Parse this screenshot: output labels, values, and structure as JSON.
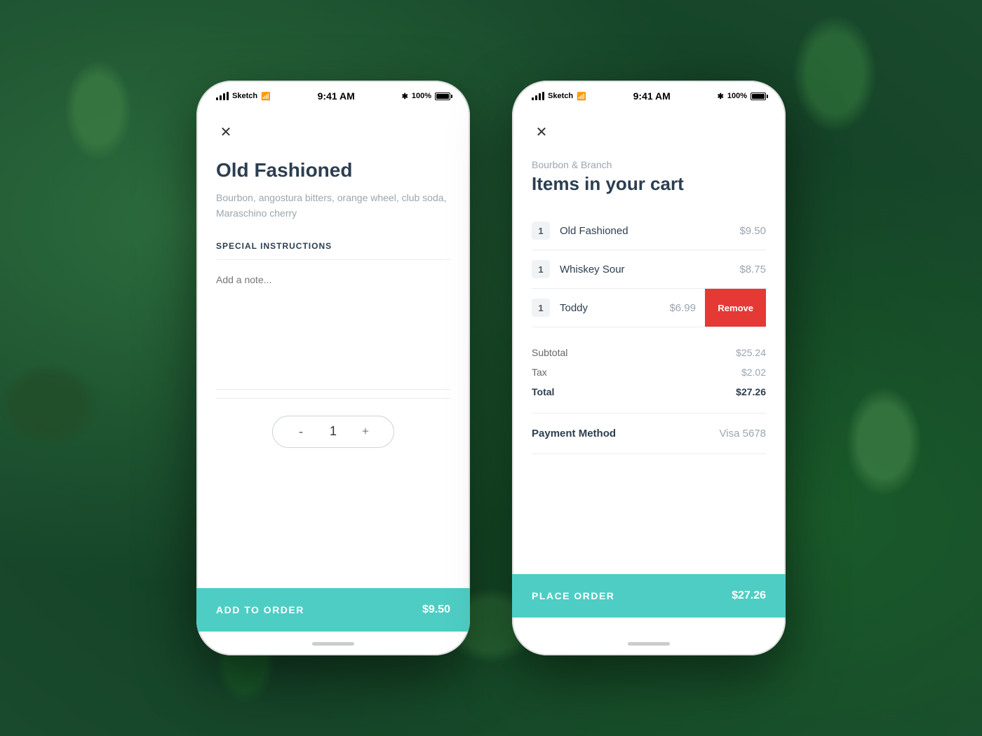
{
  "background": {
    "color": "#1a4a2e"
  },
  "phone_left": {
    "status_bar": {
      "carrier": "Sketch",
      "time": "9:41 AM",
      "battery_pct": "100%"
    },
    "close_label": "✕",
    "drink": {
      "title": "Old Fashioned",
      "ingredients": "Bourbon, angostura bitters, orange wheel,\nclub soda, Maraschino cherry"
    },
    "special_instructions": {
      "label": "SPECIAL INSTRUCTIONS",
      "placeholder": "Add a note..."
    },
    "quantity": {
      "minus": "-",
      "value": "1",
      "plus": "+"
    },
    "add_button": {
      "label": "ADD TO ORDER",
      "price": "$9.50"
    }
  },
  "phone_right": {
    "status_bar": {
      "carrier": "Sketch",
      "time": "9:41 AM",
      "battery_pct": "100%"
    },
    "close_label": "✕",
    "restaurant": "Bourbon & Branch",
    "cart_title": "Items in your cart",
    "items": [
      {
        "qty": "1",
        "name": "Old Fashioned",
        "price": "$9.50",
        "has_remove": false
      },
      {
        "qty": "1",
        "name": "Whiskey Sour",
        "price": "$8.75",
        "has_remove": false
      },
      {
        "qty": "1",
        "name": "Toddy",
        "price": "$6.99",
        "has_remove": true
      }
    ],
    "remove_label": "Remove",
    "subtotal": {
      "label": "Subtotal",
      "value": "$25.24"
    },
    "tax": {
      "label": "Tax",
      "value": "$2.02"
    },
    "total": {
      "label": "Total",
      "value": "$27.26"
    },
    "payment": {
      "label": "Payment Method",
      "value": "Visa 5678"
    },
    "place_order_btn": {
      "label": "PLACE ORDER",
      "price": "$27.26"
    }
  }
}
